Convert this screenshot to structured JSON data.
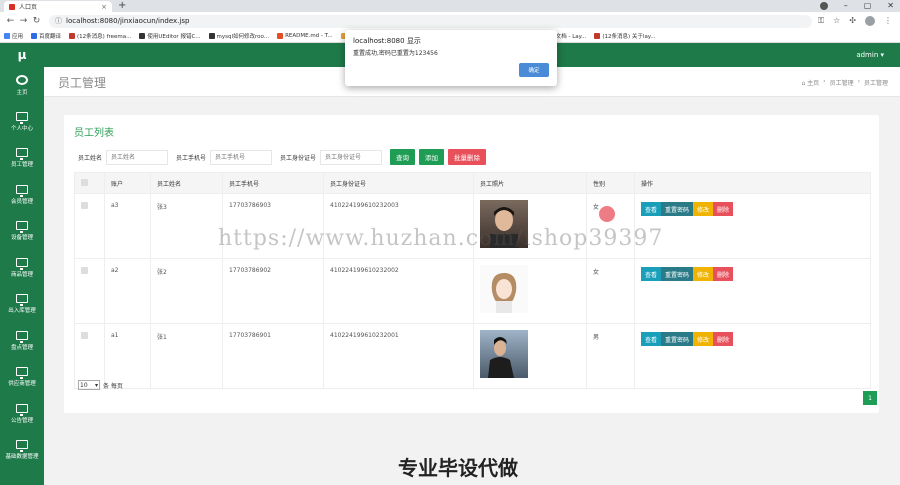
{
  "browser": {
    "tab_title": "人口页",
    "tab_close": "×",
    "newtab": "+",
    "url": "localhost:8080/jinxiaocun/index.jsp",
    "bookmarks": [
      {
        "label": "应用",
        "color": "#4285f4"
      },
      {
        "label": "百度翻译",
        "color": "#2e6be6"
      },
      {
        "label": "(12条消息) freema...",
        "color": "#c0392b"
      },
      {
        "label": "使用UEditor 报错C...",
        "color": "#333333"
      },
      {
        "label": "mysql如何修改roo...",
        "color": "#333333"
      },
      {
        "label": "README.md - T...",
        "color": "#e44d26"
      },
      {
        "label": "JS日期格式化",
        "color": "#e8a33d"
      },
      {
        "label": "如何用正则匹配: 2...",
        "color": "#e8505b"
      },
      {
        "label": "layDate - JS日期与...",
        "color": "#222222"
      },
      {
        "label": "表单模块文档 - Lay...",
        "color": "#222222"
      },
      {
        "label": "(12条消息) 关于lay...",
        "color": "#c0392b"
      }
    ]
  },
  "app": {
    "logo": "μ",
    "admin": "admin ▾",
    "page_title": "员工管理",
    "breadcrumb": [
      "⌂ 主页",
      "›",
      "员工管理",
      "›",
      "员工管理"
    ]
  },
  "sidebar": {
    "items": [
      {
        "label": "主页"
      },
      {
        "label": "个人中心"
      },
      {
        "label": "员工管理"
      },
      {
        "label": "会员管理"
      },
      {
        "label": "设备管理"
      },
      {
        "label": "商品管理"
      },
      {
        "label": "出入库管理"
      },
      {
        "label": "盘点管理"
      },
      {
        "label": "供应商管理"
      },
      {
        "label": "公告管理"
      },
      {
        "label": "基础数据管理"
      }
    ]
  },
  "list": {
    "title": "员工列表",
    "filters": [
      {
        "label": "员工姓名",
        "placeholder": "员工姓名"
      },
      {
        "label": "员工手机号",
        "placeholder": "员工手机号"
      },
      {
        "label": "员工身份证号",
        "placeholder": "员工身份证号"
      }
    ],
    "buttons": {
      "search": "查询",
      "add": "添加",
      "batch_delete": "批量删除"
    },
    "columns": [
      "账户",
      "员工姓名",
      "员工手机号",
      "员工身份证号",
      "员工照片",
      "性别",
      "操作"
    ],
    "rows": [
      {
        "account": "a3",
        "name": "张3",
        "phone": "17703786903",
        "idcard": "410224199610232003",
        "gender": "女"
      },
      {
        "account": "a2",
        "name": "张2",
        "phone": "17703786902",
        "idcard": "410224199610232002",
        "gender": "女"
      },
      {
        "account": "a1",
        "name": "张1",
        "phone": "17703786901",
        "idcard": "410224199610232001",
        "gender": "男"
      }
    ],
    "ops": {
      "view": "查看",
      "reset": "重置密码",
      "edit": "修改",
      "delete": "删除"
    },
    "page_size": "10",
    "page_size_suffix": "条 每页",
    "page_number": "1"
  },
  "dialog": {
    "title": "localhost:8080 显示",
    "message": "重置成功,密码已重置为123456",
    "ok": "确定"
  },
  "overlay": {
    "watermark": "https://www.huzhan.com/ishop39397",
    "bottom": "专业毕设代做"
  }
}
